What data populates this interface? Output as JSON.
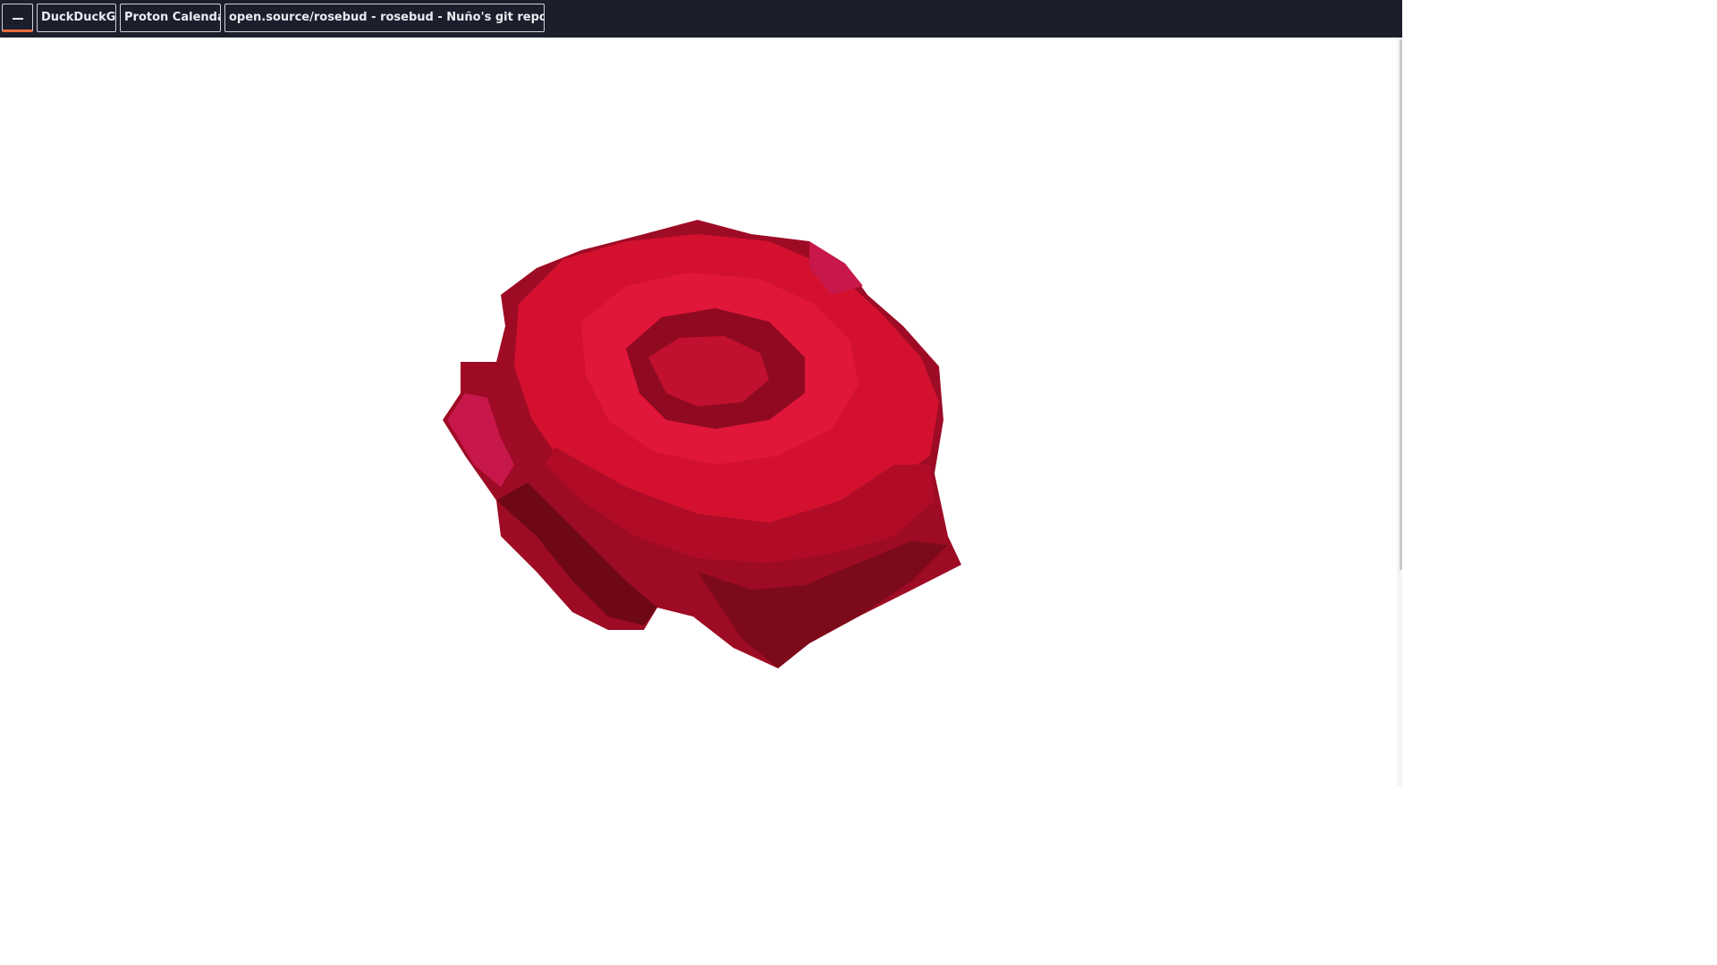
{
  "tabs": [
    {
      "label": "DuckDuckGo"
    },
    {
      "label": "Proton Calendar"
    },
    {
      "label": "open.source/rosebud - rosebud - Nuño's git repositories"
    }
  ],
  "menu": {
    "icon": "menu-dash-icon",
    "accent": "#e8693c"
  },
  "colors": {
    "tabbar_bg": "#1c1f2b",
    "rose_main": "#c8102e",
    "rose_dark": "#7a0a1c",
    "page_bg": "#ffffff"
  },
  "main": {
    "image": "red-rose-image"
  }
}
